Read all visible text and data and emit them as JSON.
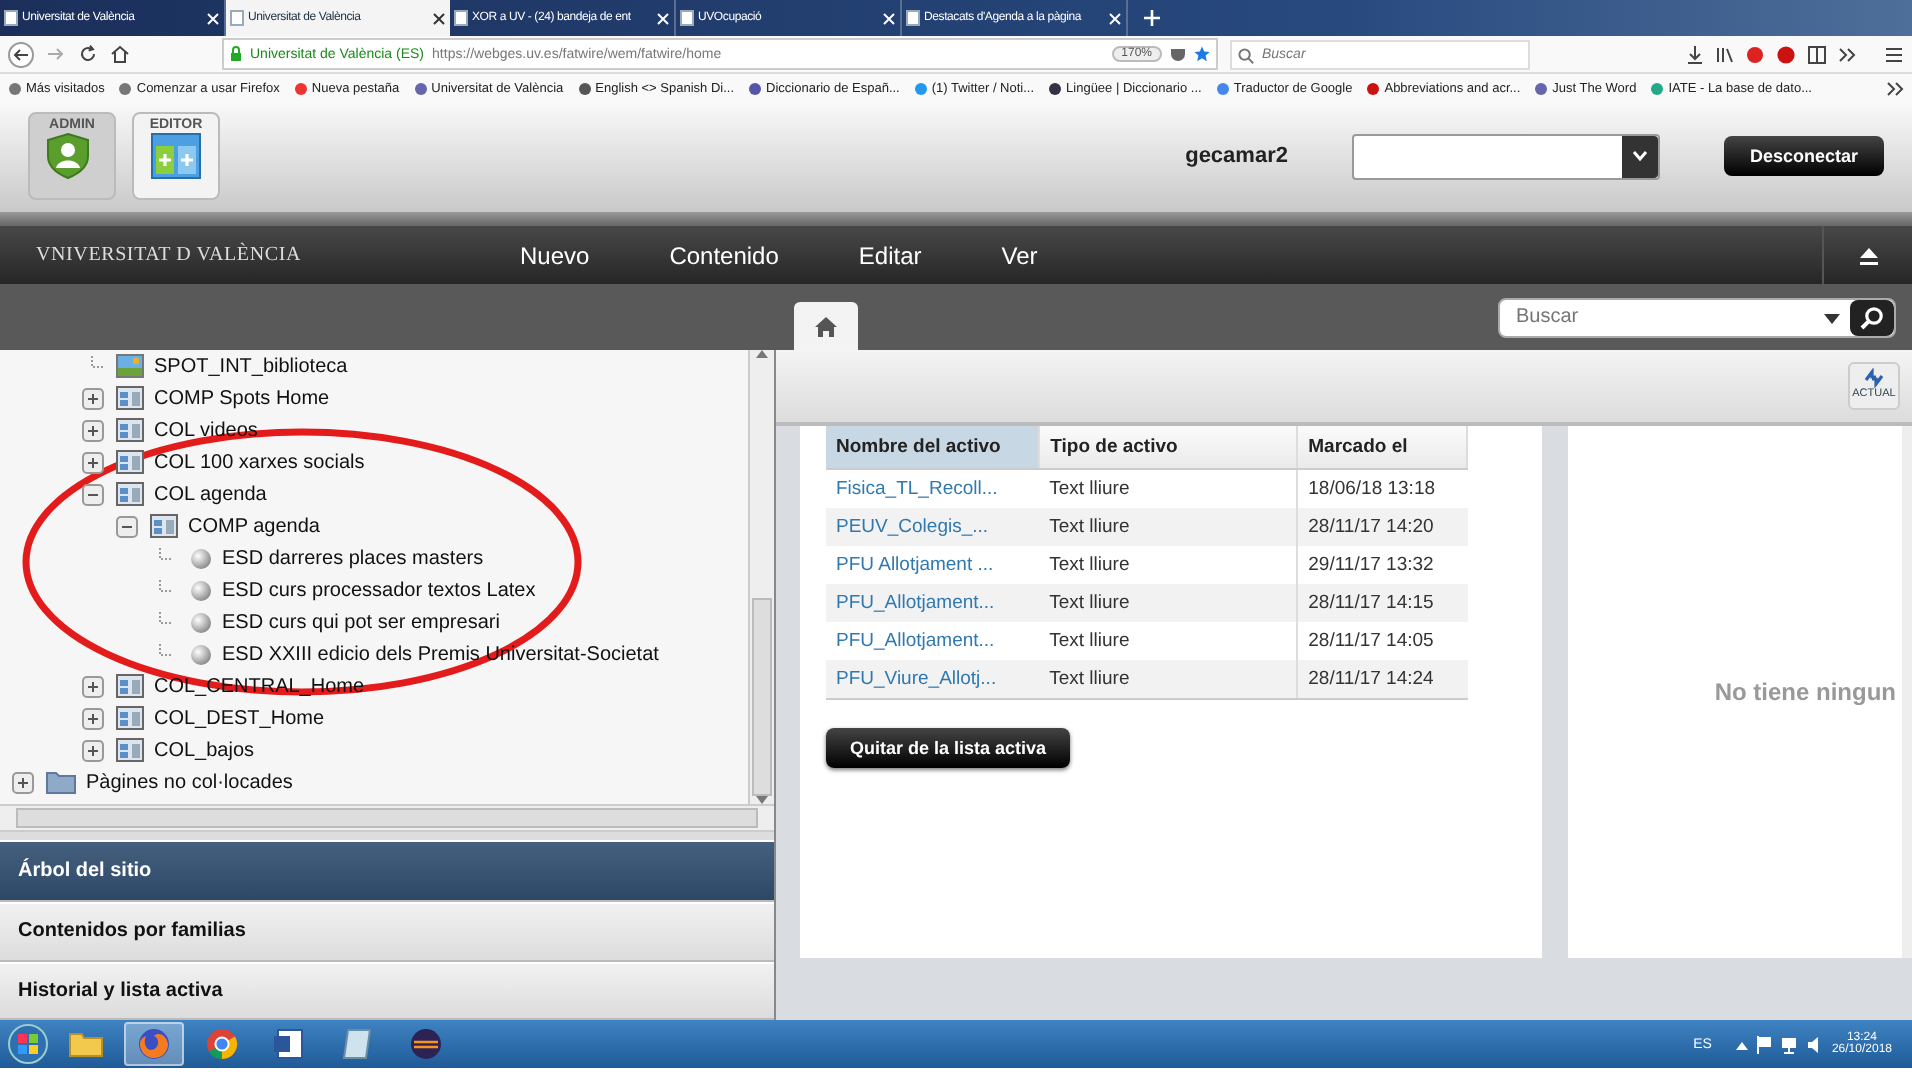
{
  "browser": {
    "tabs": [
      {
        "title": "Universitat de València",
        "selected": false
      },
      {
        "title": "Universitat de València",
        "selected": true
      },
      {
        "title": "XOR a UV - (24) bandeja de ent",
        "selected": false
      },
      {
        "title": "UVOcupació",
        "selected": false
      },
      {
        "title": "Destacats d'Agenda a la pàgina",
        "selected": false
      }
    ],
    "site_identity": "Universitat de València (ES)",
    "url": "https://webges.uv.es/fatwire/wem/fatwire/home",
    "zoom": "170%",
    "search": {
      "placeholder": "Buscar"
    },
    "bookmarks": [
      "Más visitados",
      "Comenzar a usar Firefox",
      "Nueva pestaña",
      "Universitat de València",
      "English <> Spanish Di...",
      "Diccionario de Españ...",
      "(1) Twitter / Noti...",
      "Lingüee | Diccionario ...",
      "Traductor de Google",
      "Abbreviations and acr...",
      "Just The Word",
      "IATE - La base de dato..."
    ]
  },
  "header": {
    "roles": [
      {
        "label": "ADMIN",
        "selected": false
      },
      {
        "label": "EDITOR",
        "selected": true
      }
    ],
    "user": "gecamar2",
    "logout": "Desconectar"
  },
  "navbar": {
    "logo": "VNIVERSITAT D VALÈNCIA",
    "menu": [
      "Nuevo",
      "Contenido",
      "Editar",
      "Ver"
    ]
  },
  "toolbar": {
    "search": {
      "placeholder": "Buscar"
    }
  },
  "tree": [
    {
      "children": [
        {
          "label": "SPOT_INT_biblioteca",
          "kind": "image"
        },
        {
          "label": "COMP Spots Home",
          "kind": "collection",
          "expanded": false
        },
        {
          "label": "COL videos",
          "kind": "collection",
          "expanded": false
        },
        {
          "label": "COL 100 xarxes socials",
          "kind": "collection",
          "expanded": false
        },
        {
          "label": "COL agenda",
          "kind": "collection",
          "expanded": true,
          "children": [
            {
              "label": "COMP agenda",
              "kind": "collection",
              "expanded": true,
              "children": [
                {
                  "label": "ESD darreres places masters",
                  "kind": "asset"
                },
                {
                  "label": "ESD curs processador textos Latex",
                  "kind": "asset"
                },
                {
                  "label": "ESD curs qui pot ser empresari",
                  "kind": "asset"
                },
                {
                  "label": "ESD XXIII edicio dels Premis Universitat-Societat",
                  "kind": "asset"
                }
              ]
            }
          ]
        },
        {
          "label": "COL_CENTRAL_Home",
          "kind": "collection",
          "expanded": false
        },
        {
          "label": "COL_DEST_Home",
          "kind": "collection",
          "expanded": false
        },
        {
          "label": "COL_bajos",
          "kind": "collection",
          "expanded": false
        }
      ]
    },
    {
      "label": "Pàgines no col·locades",
      "kind": "folder",
      "expanded": false
    }
  ],
  "accordion": [
    {
      "label": "Árbol del sitio",
      "selected": true
    },
    {
      "label": "Contenidos por familias",
      "selected": false
    },
    {
      "label": "Historial y lista activa",
      "selected": false
    }
  ],
  "refresh_button": "ACTUAL",
  "table": {
    "columns": [
      {
        "label": "Nombre del activo",
        "sorted": true
      },
      {
        "label": "Tipo de activo",
        "sorted": false
      },
      {
        "label": "Marcado el",
        "sorted": false
      }
    ],
    "rows": [
      [
        "Fisica_TL_Recoll...",
        "Text lliure",
        "18/06/18 13:18"
      ],
      [
        "PEUV_Colegis_...",
        "Text lliure",
        "28/11/17 14:20"
      ],
      [
        "PFU Allotjament ...",
        "Text lliure",
        "29/11/17 13:32"
      ],
      [
        "PFU_Allotjament...",
        "Text lliure",
        "28/11/17 14:15"
      ],
      [
        "PFU_Allotjament...",
        "Text lliure",
        "28/11/17 14:05"
      ],
      [
        "PFU_Viure_Allotj...",
        "Text lliure",
        "28/11/17 14:24"
      ]
    ]
  },
  "remove_button": "Quitar de la lista activa",
  "empty_message": "No tiene ningun",
  "taskbar": {
    "apps": [
      {
        "kind": "folder",
        "selected": false
      },
      {
        "kind": "firefox",
        "selected": true
      },
      {
        "kind": "chrome",
        "selected": false
      },
      {
        "kind": "word",
        "selected": false
      },
      {
        "kind": "notes",
        "selected": false
      },
      {
        "kind": "eclipse",
        "selected": false
      }
    ],
    "language": "ES",
    "time": "13:24",
    "date": "26/10/2018"
  }
}
